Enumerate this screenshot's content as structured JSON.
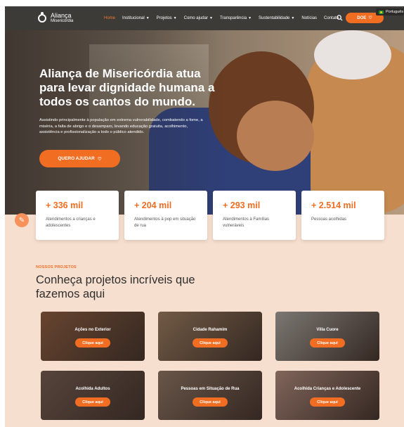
{
  "nav": {
    "logo_line1": "Aliança",
    "logo_line2": "Misericórdia",
    "items": [
      {
        "label": "Home",
        "caret": false
      },
      {
        "label": "Institucional",
        "caret": true
      },
      {
        "label": "Projetos",
        "caret": true
      },
      {
        "label": "Como ajudar",
        "caret": true
      },
      {
        "label": "Transparência",
        "caret": true
      },
      {
        "label": "Sustentabilidade",
        "caret": true
      },
      {
        "label": "Notícias",
        "caret": false
      },
      {
        "label": "Contato",
        "caret": false
      }
    ],
    "donate_label": "DOE",
    "language": "Português"
  },
  "hero": {
    "title": "Aliança de Misericórdia atua para levar dignidade humana a todos os cantos do mundo.",
    "text": "Assistindo principalmente à população em extrema vulnerabilidade, combatendo a fome, a miséria, a falta de abrigo e o desamparo, levando educação gratuita, acolhimento, assistência e profissionalização a todo o público atendido.",
    "cta_label": "QUERO AJUDAR"
  },
  "stats": [
    {
      "number": "+ 336 mil",
      "label": "Atendimentos a crianças e adolescentes"
    },
    {
      "number": "+ 204 mil",
      "label": "Atendimentos à pop em situação de rua"
    },
    {
      "number": "+ 293 mil",
      "label": "Atendimentos à Famílias vulneráveis"
    },
    {
      "number": "+ 2.514 mil",
      "label": "Pessoas acolhidas"
    }
  ],
  "projects": {
    "kicker": "NOSSOS PROJETOS",
    "title": "Conheça projetos incríveis que fazemos aqui",
    "cards": [
      {
        "title": "Ações no Exterior",
        "button": "Clique aqui",
        "color": "#8a5a3b"
      },
      {
        "title": "Cidade Rahamim",
        "button": "Clique aqui",
        "color": "#9a7c5e"
      },
      {
        "title": "Villa Cuore",
        "button": "Clique aqui",
        "color": "#a8a7a2"
      },
      {
        "title": "Acolhida Adultos",
        "button": "Clique aqui",
        "color": "#6f5a4e"
      },
      {
        "title": "Pessoas em Situação de Rua",
        "button": "Clique aqui",
        "color": "#8c7563"
      },
      {
        "title": "Acolhida Crianças e Adolescente",
        "button": "Clique aqui",
        "color": "#b08c7e"
      }
    ]
  },
  "colors": {
    "accent": "#f16d22",
    "nav_bg": "#3d3b38",
    "section_bg": "#f7dfcf"
  }
}
